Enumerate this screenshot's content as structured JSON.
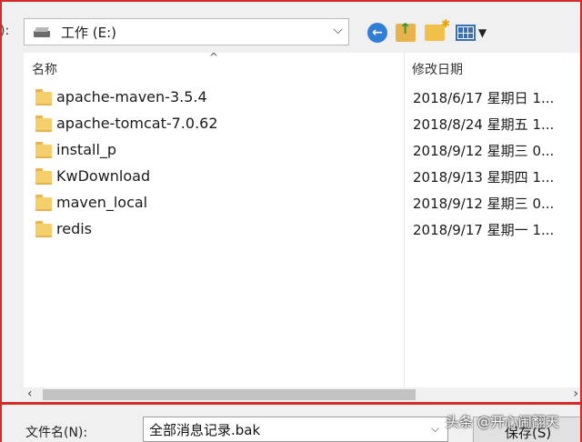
{
  "top_label": "):",
  "location": {
    "drive_label": "工作 (E:)"
  },
  "list": {
    "column_name": "名称",
    "column_date": "修改日期",
    "items": [
      {
        "name": "apache-maven-3.5.4",
        "date": "2018/6/17 星期日 1..."
      },
      {
        "name": "apache-tomcat-7.0.62",
        "date": "2018/8/24 星期五 1..."
      },
      {
        "name": "install_p",
        "date": "2018/9/12 星期三 0..."
      },
      {
        "name": "KwDownload",
        "date": "2018/9/13 星期四 1..."
      },
      {
        "name": "maven_local",
        "date": "2018/9/12 星期三 0..."
      },
      {
        "name": "redis",
        "date": "2018/9/17 星期一 1..."
      }
    ]
  },
  "footer": {
    "filename_label": "文件名(N):",
    "filename_value": "全部消息记录.bak",
    "save_label": "保存(S)"
  },
  "watermark": "头条 @开心闹翻天",
  "icons": {
    "back": "back-arrow-icon",
    "up": "up-folder-icon",
    "new_folder": "new-folder-icon",
    "view": "view-menu-icon",
    "drive": "drive-icon",
    "folder": "folder-icon"
  },
  "colors": {
    "highlight_frame": "#d42a2a",
    "accent_blue": "#2f7fd8"
  }
}
